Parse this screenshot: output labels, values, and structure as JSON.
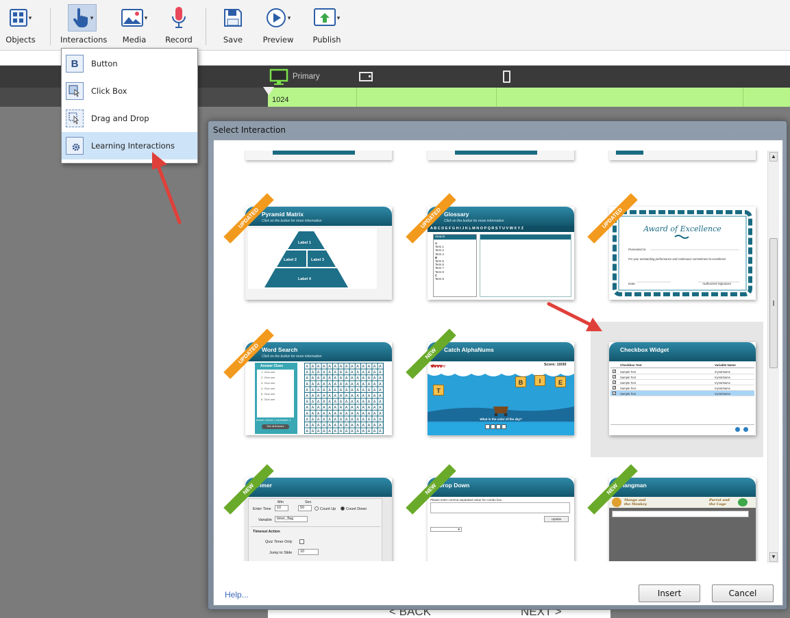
{
  "toolbar": {
    "objects": "Objects",
    "interactions": "Interactions",
    "media": "Media",
    "record": "Record",
    "save": "Save",
    "preview": "Preview",
    "publish": "Publish"
  },
  "menu": {
    "items": [
      {
        "label": "Button",
        "icon": "B"
      },
      {
        "label": "Click Box"
      },
      {
        "label": "Drag and Drop"
      },
      {
        "label": "Learning Interactions"
      }
    ]
  },
  "breakpoints": {
    "primary": "Primary",
    "ruler_value": "1024"
  },
  "stage": {
    "back": "< BACK",
    "next": "NEXT >"
  },
  "dialog": {
    "title": "Select Interaction",
    "help": "Help...",
    "insert": "Insert",
    "cancel": "Cancel",
    "tiles": [
      {
        "title": "Pyramid Matrix",
        "subtitle": "Click on the button for more information",
        "badge": "UPDATED"
      },
      {
        "title": "Glossary",
        "subtitle": "Click on the button for more information",
        "badge": "UPDATED"
      },
      {
        "title": "Award of Excellence",
        "badge": "UPDATED"
      },
      {
        "title": "Word Search",
        "subtitle": "Click on the button for more information",
        "badge": "UPDATED"
      },
      {
        "title": "Catch AlphaNums",
        "badge": "NEW"
      },
      {
        "title": "Checkbox Widget",
        "badge": ""
      },
      {
        "title": "Timer",
        "badge": "NEW"
      },
      {
        "title": "Drop Down",
        "badge": "NEW"
      },
      {
        "title": "Hangman",
        "badge": "NEW"
      }
    ],
    "pyramid": {
      "labels": [
        "Label 1",
        "Label 2",
        "Label 3",
        "Label 4"
      ]
    },
    "glossary": {
      "alphabet": "A B C D E F G H I J K L M N O P Q R S T U V W X Y Z",
      "search": "Search",
      "terms": [
        "A",
        "Term 1",
        "Term 2",
        "Term 4",
        "B",
        "Term 5",
        "Term 6",
        "Term 7",
        "Term 8",
        "C",
        "Term 9"
      ]
    },
    "award": {
      "presented": "Presented to",
      "line": "For your outstanding performance and continuous commitment to excellence",
      "date": "Date:",
      "signature": "Authorized Signature"
    },
    "wordsearch": {
      "answer_clues": "Answer Clues",
      "clues": [
        "1. Clue one",
        "2. Clue one",
        "3. Clue one",
        "4. Clue one",
        "5. Clue one",
        "6. Clue one"
      ],
      "footer": "Answer Correct: 1 out Answer: 4",
      "button": "See all Answers"
    },
    "catch": {
      "score": "Score: 10/30",
      "letters": [
        "T",
        "B",
        "I",
        "E"
      ],
      "question": "What is the color of the sky?"
    },
    "checkbox": {
      "col1": "Checkbox Text",
      "col2": "Variable Name",
      "rows": [
        "Sample Text",
        "Sample Text",
        "Sample Text",
        "Sample Text",
        "Sample Text"
      ],
      "var": "myVarName"
    },
    "timer": {
      "enter_time": "Enter Time",
      "min": "Min",
      "sec": "Sec",
      "min_val": "10",
      "sec_val": "50",
      "count_up": "Count Up",
      "count_down": "Count Down",
      "variable": "Variable",
      "variable_val": "timer_flag",
      "timeout": "Timeout Action",
      "quiz_timer": "Quiz Timer Only",
      "jump": "Jump to Slide",
      "jump_val": "10"
    },
    "dropdown": {
      "prompt": "Please enter comma separated value for combo box",
      "update": "Update"
    },
    "hangman": {
      "left": "Mango and the Monkey",
      "right": "Parrot and the Cage"
    }
  },
  "colors": {
    "accent": "#12566d",
    "updated_badge": "#f29a1e",
    "new_badge": "#6aaa2a",
    "ruler_green": "#b7f58a",
    "arrow": "#e0403a"
  }
}
